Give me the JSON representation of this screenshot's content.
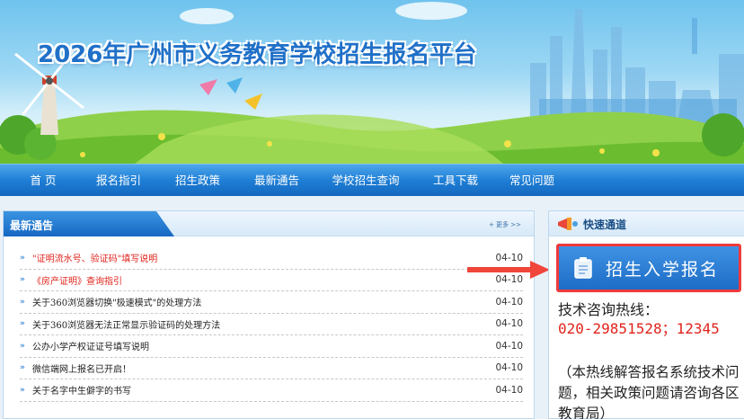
{
  "header": {
    "title": "2026年广州市义务教育学校招生报名平台"
  },
  "nav": {
    "items": [
      {
        "label": "首 页",
        "width": 80
      },
      {
        "label": "报名指引",
        "width": 88
      },
      {
        "label": "招生政策",
        "width": 88
      },
      {
        "label": "最新通告",
        "width": 88
      },
      {
        "label": "学校招生查询",
        "width": 110
      },
      {
        "label": "工具下载",
        "width": 90
      },
      {
        "label": "常见问题",
        "width": 80
      }
    ]
  },
  "news": {
    "heading": "最新通告",
    "more_label": "+ 更多 >>",
    "rows": [
      {
        "title": "\"证明流水号、验证码\"填写说明",
        "date": "04-10",
        "highlight": true
      },
      {
        "title": "《房产证明》查询指引",
        "date": "04-10",
        "highlight": true
      },
      {
        "title": "关于360浏览器切换\"极速模式\"的处理方法",
        "date": "04-10",
        "highlight": false
      },
      {
        "title": "关于360浏览器无法正常显示验证码的处理方法",
        "date": "04-10",
        "highlight": false
      },
      {
        "title": "公办小学产权证证号填写说明",
        "date": "04-10",
        "highlight": false
      },
      {
        "title": "微信端网上报名已开启！",
        "date": "04-10",
        "highlight": false
      },
      {
        "title": "关于名字中生僻字的书写",
        "date": "04-10",
        "highlight": false
      }
    ]
  },
  "quick": {
    "heading": "快速通道",
    "enroll_label": "招生入学报名",
    "hotline_label": "技术咨询热线：",
    "hotline_number": "020-29851528；12345",
    "hotline_note": "（本热线解答报名系统技术问题，相关政策问题请咨询各区教育局）"
  },
  "colors": {
    "nav_blue": "#1f7fd6",
    "highlight_red": "#e0231b",
    "button_border": "#f03a3a"
  }
}
